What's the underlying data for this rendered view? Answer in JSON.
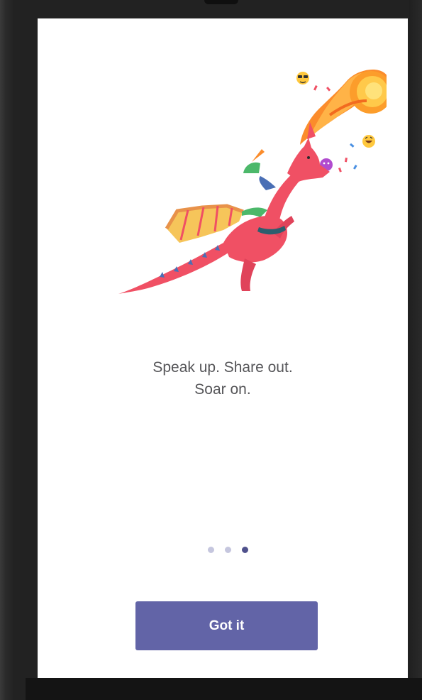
{
  "onboarding": {
    "tagline_line1": "Speak up. Share out.",
    "tagline_line2": "Soar on.",
    "button_label": "Got it",
    "pager": {
      "total": 3,
      "current": 3
    },
    "illustration_icon": "dragon-breathing-fire-with-emoji-icon"
  },
  "colors": {
    "screen_background": "#ffffff",
    "device_frame": "#222222",
    "button_background": "#6264a7",
    "button_text": "#ffffff",
    "tagline_text": "#555558",
    "dot_inactive": "#c5c6de",
    "dot_active": "#4f518c",
    "dragon_body": "#f05064",
    "wing_yellow": "#f6c55a",
    "fire_orange": "#fb8c2b"
  }
}
